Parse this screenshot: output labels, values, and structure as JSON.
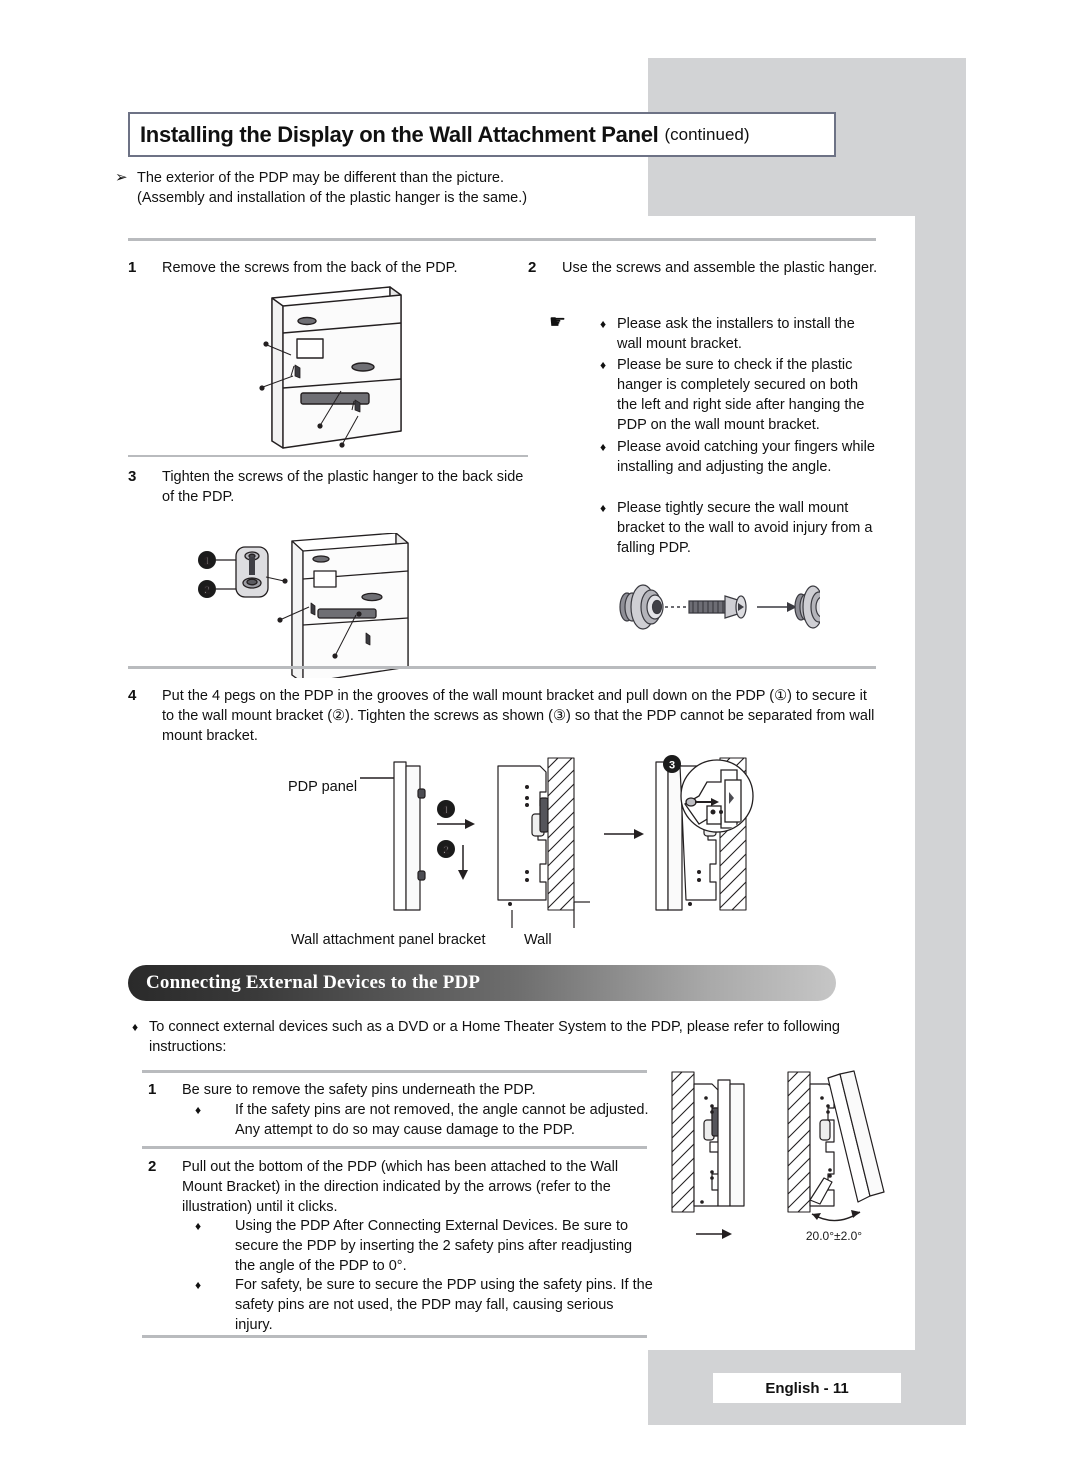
{
  "title": {
    "main": "Installing the Display on the Wall Attachment Panel",
    "continued": "(continued)"
  },
  "intro_note": {
    "bullet": "➢",
    "line1": "The exterior of the PDP may be different than the picture.",
    "line2": "(Assembly and installation of the plastic hanger is the same.)"
  },
  "steps": {
    "s1": {
      "num": "1",
      "text": "Remove the screws from the back of the PDP."
    },
    "s2": {
      "num": "2",
      "text": "Use the screws and assemble the plastic hanger.",
      "hand_icon": "☛",
      "bullet": "♦",
      "notes": [
        "Please ask the installers to install the wall mount bracket.",
        "Please be sure to check if the plastic hanger is completely secured on both the left and right side after hanging the PDP on the wall mount bracket.",
        "Please avoid catching your fingers while installing and adjusting the angle.",
        "Please tightly secure the wall mount bracket to the wall to avoid injury from a falling PDP."
      ]
    },
    "s3": {
      "num": "3",
      "text": "Tighten the screws of the plastic hanger to the back side of the PDP.",
      "callout_1": "❶",
      "callout_2": "❷"
    },
    "s4": {
      "num": "4",
      "text": "Put the 4 pegs on the PDP in the grooves of the wall mount bracket and pull down on the PDP (①) to secure it to the wall mount bracket (②). Tighten the screws as shown (③) so that the PDP cannot be separated from wall mount bracket.",
      "callout_1": "❶",
      "callout_2": "❷",
      "callout_3": "❸",
      "labels": {
        "pdp_panel": "PDP panel",
        "bracket": "Wall attachment panel bracket",
        "wall": "Wall"
      }
    }
  },
  "section": {
    "banner_title": "Connecting External Devices to the PDP",
    "lead_bullet": "♦",
    "lead_text": "To connect external devices such as a DVD or a Home Theater System to the PDP, please refer to following instructions:",
    "items": [
      {
        "num": "1",
        "text": "Be sure to remove the safety pins underneath the PDP.",
        "bullets": [
          "If the safety pins are not removed, the angle cannot be adjusted. Any attempt to do so may cause damage to the PDP."
        ]
      },
      {
        "num": "2",
        "text": "Pull out the bottom of the PDP (which has been attached to the Wall Mount Bracket) in the direction indicated by the arrows (refer to the illustration) until it clicks.",
        "bullets": [
          "Using the PDP After Connecting External Devices. Be sure to secure the PDP by inserting the 2 safety pins after readjusting the angle of the PDP to 0°.",
          "For safety, be sure to secure the PDP using the safety pins. If the safety pins are not used, the PDP may fall, causing serious injury."
        ]
      }
    ],
    "angle_label": "20.0°±2.0°"
  },
  "footer": {
    "page_label": "English - 11"
  },
  "colors": {
    "gray_block": "#d2d3d5",
    "title_border": "#6d7285",
    "rule": "#b9bbbe",
    "banner_dark": "#2a2a2a",
    "banner_light": "#c6c6c6"
  }
}
